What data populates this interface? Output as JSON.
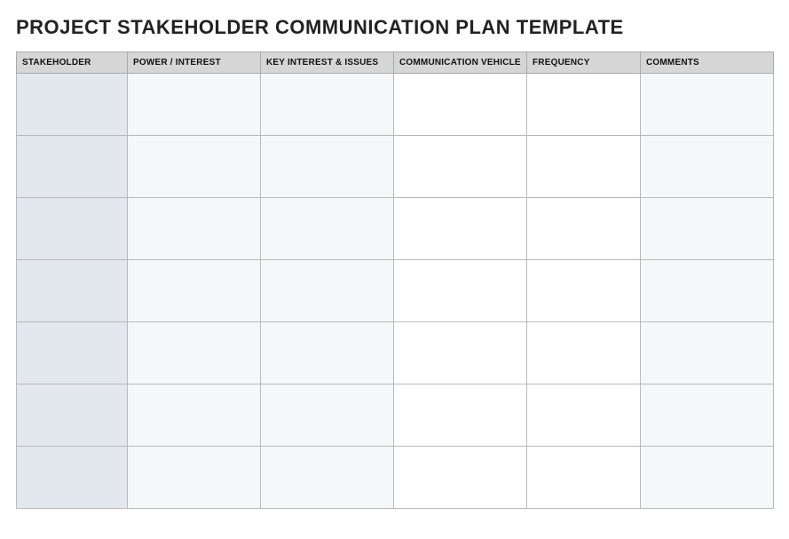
{
  "title": "PROJECT STAKEHOLDER COMMUNICATION PLAN TEMPLATE",
  "columns": [
    "STAKEHOLDER",
    "POWER / INTEREST",
    "KEY INTEREST & ISSUES",
    "COMMUNICATION VEHICLE",
    "FREQUENCY",
    "COMMENTS"
  ],
  "rows": [
    {
      "stakeholder": "",
      "power_interest": "",
      "key_interest_issues": "",
      "communication_vehicle": "",
      "frequency": "",
      "comments": ""
    },
    {
      "stakeholder": "",
      "power_interest": "",
      "key_interest_issues": "",
      "communication_vehicle": "",
      "frequency": "",
      "comments": ""
    },
    {
      "stakeholder": "",
      "power_interest": "",
      "key_interest_issues": "",
      "communication_vehicle": "",
      "frequency": "",
      "comments": ""
    },
    {
      "stakeholder": "",
      "power_interest": "",
      "key_interest_issues": "",
      "communication_vehicle": "",
      "frequency": "",
      "comments": ""
    },
    {
      "stakeholder": "",
      "power_interest": "",
      "key_interest_issues": "",
      "communication_vehicle": "",
      "frequency": "",
      "comments": ""
    },
    {
      "stakeholder": "",
      "power_interest": "",
      "key_interest_issues": "",
      "communication_vehicle": "",
      "frequency": "",
      "comments": ""
    },
    {
      "stakeholder": "",
      "power_interest": "",
      "key_interest_issues": "",
      "communication_vehicle": "",
      "frequency": "",
      "comments": ""
    }
  ]
}
